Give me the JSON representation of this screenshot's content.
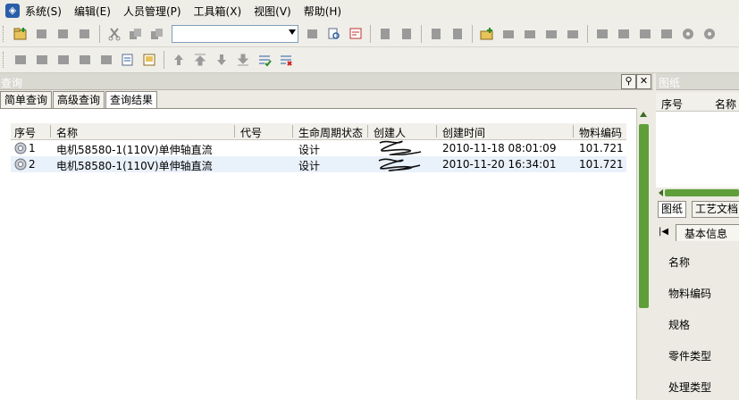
{
  "menubar": {
    "items": [
      "系统(S)",
      "编辑(E)",
      "人员管理(P)",
      "工具箱(X)",
      "视图(V)",
      "帮助(H)"
    ]
  },
  "toolbar": {
    "combo_value": ""
  },
  "query_panel": {
    "title": "查询",
    "tabs": [
      "简单查询",
      "高级查询",
      "查询结果"
    ],
    "active_tab": "查询结果",
    "columns": [
      "序号",
      "名称",
      "代号",
      "生命周期状态",
      "创建人",
      "创建时间",
      "物料编码"
    ],
    "rows": [
      {
        "index": "1",
        "name": "电机58580-1(110V)单伸轴直流",
        "code": "",
        "state": "设计",
        "creator": "",
        "created": "2010-11-18 08:01:09",
        "material_code": "101.721"
      },
      {
        "index": "2",
        "name": "电机58580-1(110V)单伸轴直流",
        "code": "",
        "state": "设计",
        "creator": "",
        "created": "2010-11-20 16:34:01",
        "material_code": "101.721"
      }
    ]
  },
  "drawing_panel": {
    "title": "图纸",
    "columns": [
      "序号",
      "名称"
    ],
    "tabs": [
      "图纸",
      "工艺文档"
    ],
    "subtab": "基本信息",
    "fields": [
      "名称",
      "物料编码",
      "规格",
      "零件类型",
      "处理类型"
    ]
  },
  "colors": {
    "scrollbar_thumb": "#5f9f3a",
    "selected_row": "#e9f1fb"
  }
}
